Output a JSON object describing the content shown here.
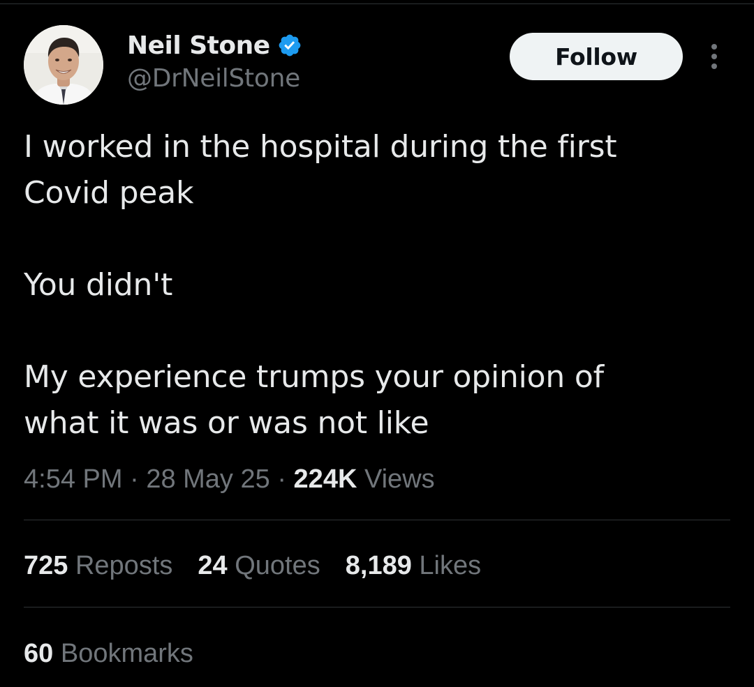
{
  "author": {
    "display_name": "Neil Stone",
    "handle": "@DrNeilStone",
    "verified_icon": "verified-badge-icon",
    "verified_color": "#1d9bf0"
  },
  "follow_label": "Follow",
  "tweet": {
    "paragraphs": [
      "I worked in the hospital during the first Covid peak",
      "You didn't",
      "My experience trumps your opinion of what it was or was not like"
    ]
  },
  "meta": {
    "time": "4:54 PM",
    "separator": "·",
    "date": "28 May 25",
    "views_count": "224K",
    "views_label": "Views"
  },
  "stats": {
    "reposts_count": "725",
    "reposts_label": "Reposts",
    "quotes_count": "24",
    "quotes_label": "Quotes",
    "likes_count": "8,189",
    "likes_label": "Likes",
    "bookmarks_count": "60",
    "bookmarks_label": "Bookmarks"
  },
  "colors": {
    "background": "#000000",
    "text_primary": "#e7e9ea",
    "text_secondary": "#71767b",
    "divider": "#2f3336",
    "follow_bg": "#eff3f4",
    "follow_text": "#0f1419"
  }
}
